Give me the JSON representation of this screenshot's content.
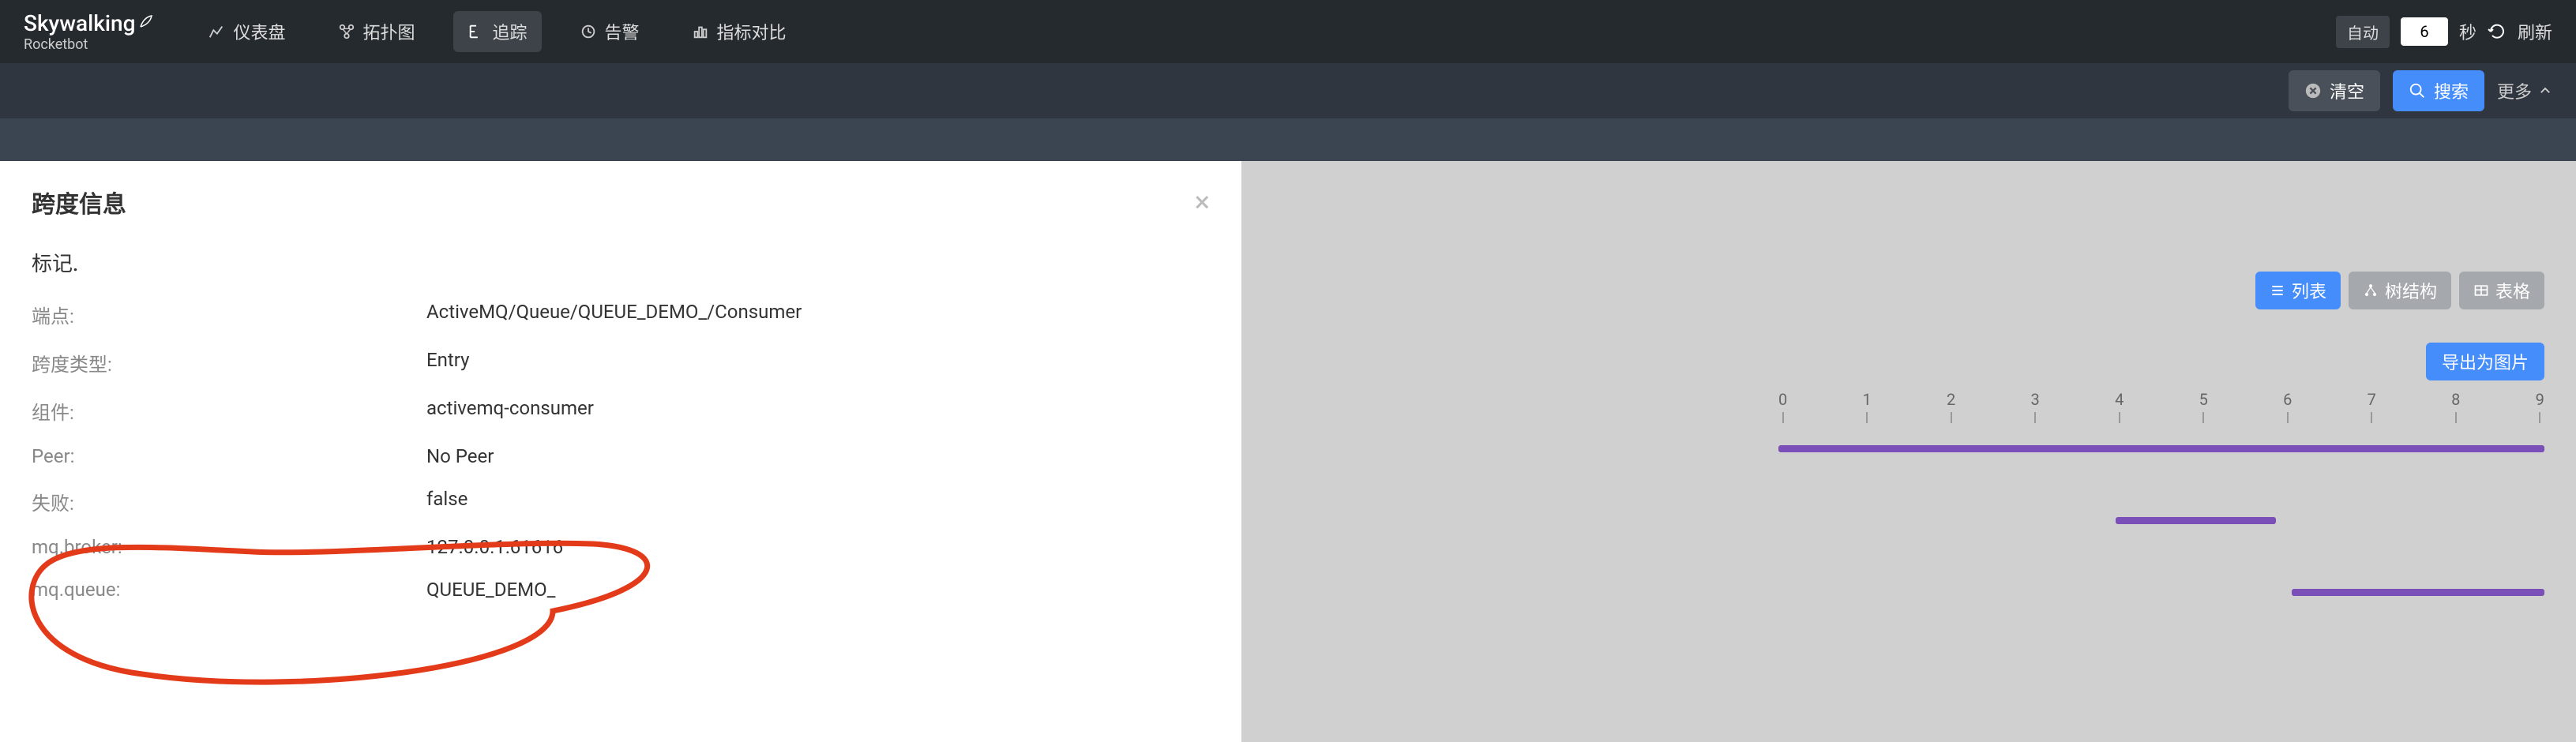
{
  "header": {
    "logo_main": "Skywalking",
    "logo_sub": "Rocketbot",
    "nav": [
      {
        "label": "仪表盘",
        "icon": "dashboard"
      },
      {
        "label": "拓扑图",
        "icon": "topology"
      },
      {
        "label": "追踪",
        "icon": "trace",
        "active": true
      },
      {
        "label": "告警",
        "icon": "alarm"
      },
      {
        "label": "指标对比",
        "icon": "compare"
      }
    ],
    "refresh_mode": "自动",
    "refresh_value": "6",
    "refresh_unit": "秒",
    "refresh_label": "刷新"
  },
  "toolbar": {
    "clear_label": "清空",
    "search_label": "搜索",
    "more_label": "更多"
  },
  "modal": {
    "title": "跨度信息",
    "subtitle": "标记.",
    "rows": [
      {
        "label": "端点:",
        "value": "ActiveMQ/Queue/QUEUE_DEMO_/Consumer"
      },
      {
        "label": "跨度类型:",
        "value": "Entry"
      },
      {
        "label": "组件:",
        "value": "activemq-consumer"
      },
      {
        "label": "Peer:",
        "value": "No Peer"
      },
      {
        "label": "失败:",
        "value": "false"
      },
      {
        "label": "mq.broker:",
        "value": "127.0.0.1:61616"
      },
      {
        "label": "mq.queue:",
        "value": "QUEUE_DEMO_"
      }
    ]
  },
  "view_toggles": {
    "list_label": "列表",
    "tree_label": "树结构",
    "table_label": "表格"
  },
  "export_label": "导出为图片",
  "timeline": {
    "ticks": [
      "0",
      "1",
      "2",
      "3",
      "4",
      "5",
      "6",
      "7",
      "8",
      "9"
    ],
    "bars": [
      {
        "start_pct": 0,
        "width_pct": 100
      },
      {
        "start_pct": 44,
        "width_pct": 21
      },
      {
        "start_pct": 67,
        "width_pct": 33
      }
    ]
  }
}
